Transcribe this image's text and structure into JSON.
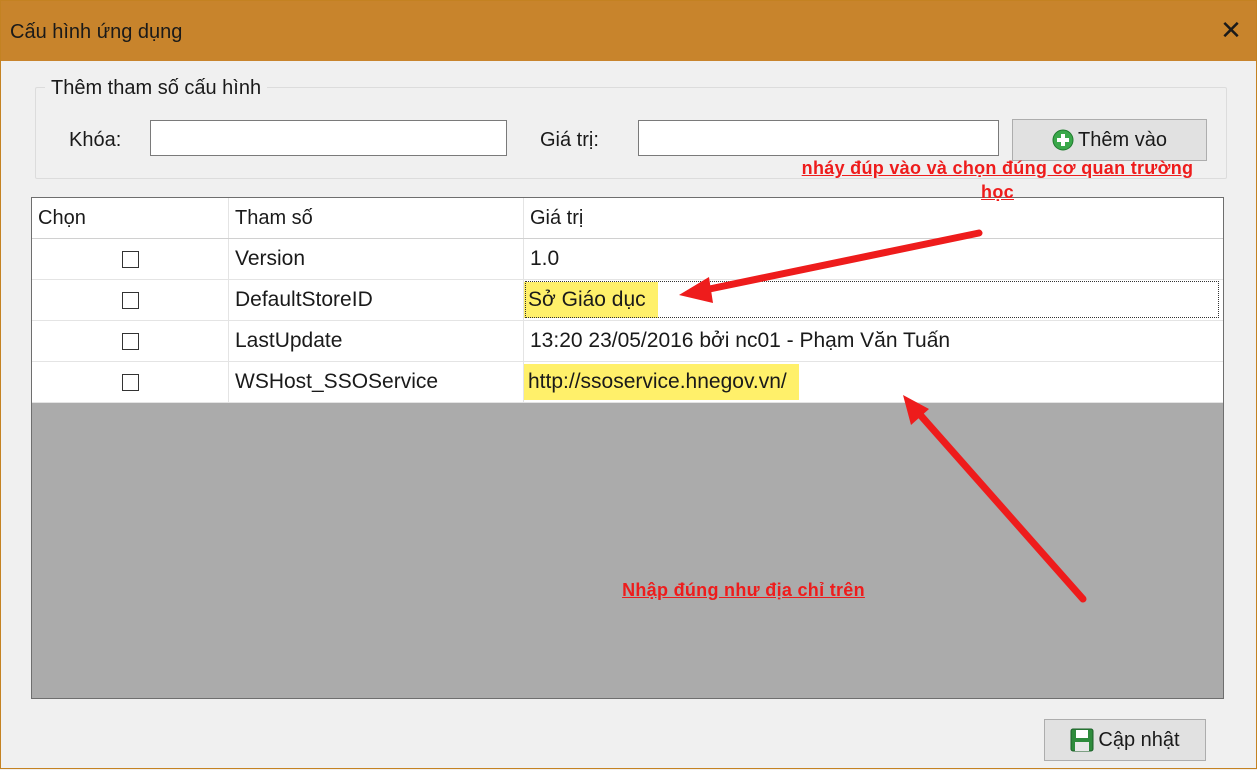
{
  "window": {
    "title": "Cấu hình ứng dụng",
    "close_glyph": "✕"
  },
  "add_group": {
    "legend": "Thêm tham số cấu hình",
    "key_label": "Khóa:",
    "key_value": "",
    "value_label": "Giá trị:",
    "value_value": "",
    "add_button": "Thêm vào",
    "add_icon": "green-plus-circle-icon"
  },
  "grid": {
    "columns": [
      "Chọn",
      "Tham số",
      "Giá trị"
    ],
    "rows": [
      {
        "checked": false,
        "param": "Version",
        "value": "1.0"
      },
      {
        "checked": false,
        "param": "DefaultStoreID",
        "value": "Sở Giáo dục"
      },
      {
        "checked": false,
        "param": "LastUpdate",
        "value": "13:20 23/05/2016 bởi nc01 - Phạm Văn Tuấn"
      },
      {
        "checked": false,
        "param": "WSHost_SSOService",
        "value": "http://ssoservice.hnegov.vn/"
      }
    ]
  },
  "annotations": {
    "note1": "nháy đúp vào và chọn đúng cơ quan trường học",
    "note2": "Nhập đúng như địa chỉ trên"
  },
  "footer": {
    "update_button": "Cập nhật",
    "update_icon": "save-disk-icon"
  },
  "colors": {
    "titlebar": "#c8842c",
    "annotation": "#ee1c1c",
    "highlight": "#fff06a",
    "grid_empty": "#ababab"
  }
}
